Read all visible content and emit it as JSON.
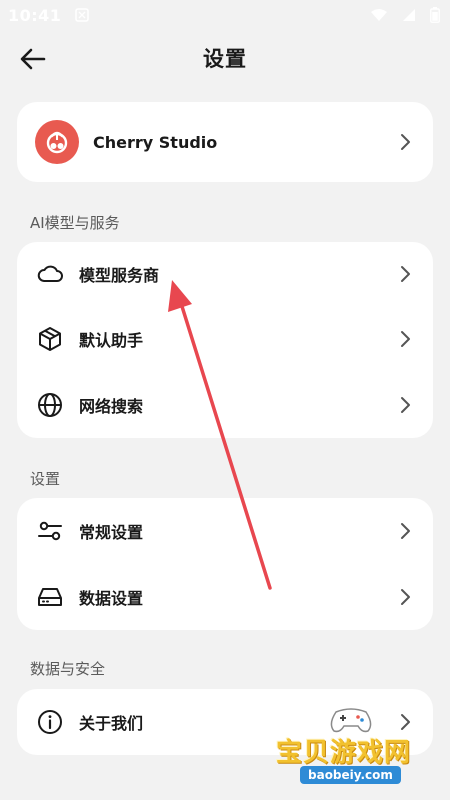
{
  "status_bar": {
    "time": "10:41"
  },
  "header": {
    "title": "设置"
  },
  "profile": {
    "name": "Cherry Studio"
  },
  "sections": {
    "ai": {
      "title": "AI模型与服务",
      "items": [
        {
          "label": "模型服务商",
          "icon": "cloud-icon"
        },
        {
          "label": "默认助手",
          "icon": "cube-icon"
        },
        {
          "label": "网络搜索",
          "icon": "globe-icon"
        }
      ]
    },
    "settings": {
      "title": "设置",
      "items": [
        {
          "label": "常规设置",
          "icon": "sliders-icon"
        },
        {
          "label": "数据设置",
          "icon": "hard-drive-icon"
        }
      ]
    },
    "data_security": {
      "title": "数据与安全",
      "items": [
        {
          "label": "关于我们",
          "icon": "info-icon"
        }
      ]
    }
  },
  "watermark": {
    "text": "宝贝游戏网",
    "url": "baobeiy.com"
  },
  "colors": {
    "background": "#f2f2f2",
    "card": "#ffffff",
    "brand": "#e85a50",
    "annotation": "#e8474f"
  }
}
